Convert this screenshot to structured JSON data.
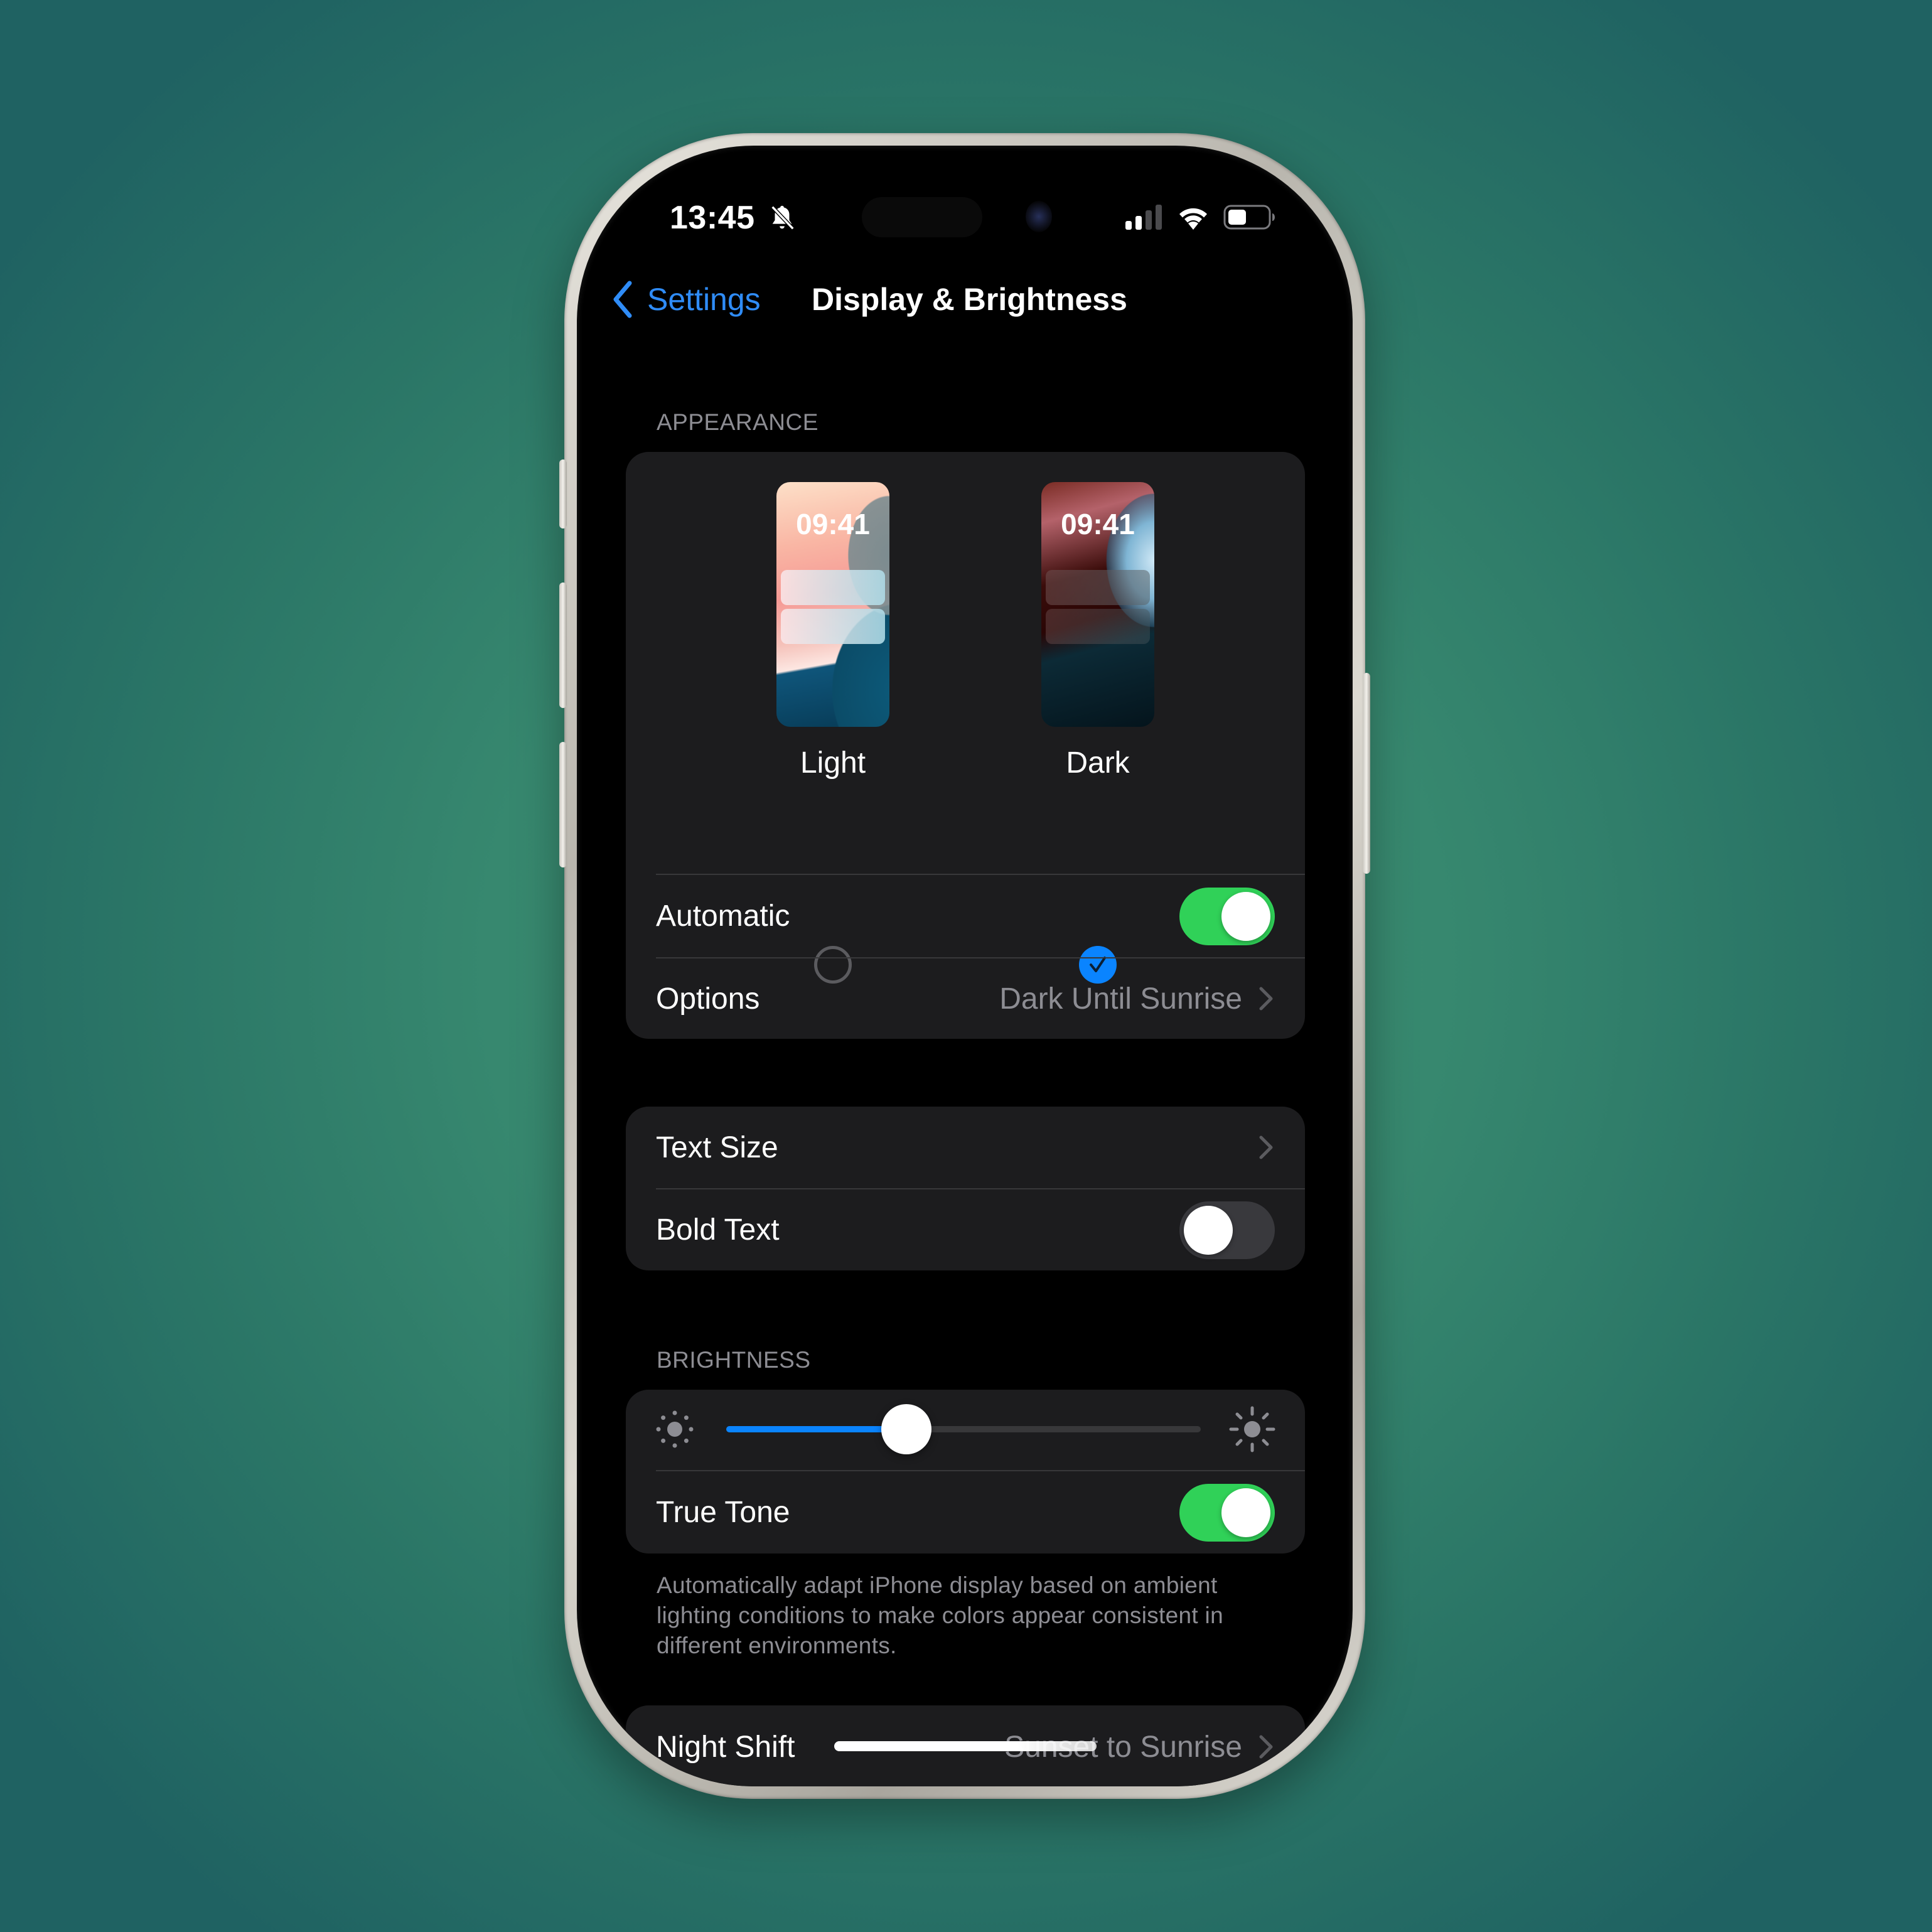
{
  "status_bar": {
    "time": "13:45",
    "silent_mode": true,
    "signal_bars_active": 2,
    "signal_bars_total": 4,
    "battery_level": 0.4
  },
  "nav": {
    "back_label": "Settings",
    "title": "Display & Brightness"
  },
  "appearance": {
    "section_label": "APPEARANCE",
    "modes": [
      {
        "label": "Light",
        "preview_time": "09:41",
        "selected": false
      },
      {
        "label": "Dark",
        "preview_time": "09:41",
        "selected": true
      }
    ],
    "automatic": {
      "label": "Automatic",
      "on": true
    },
    "options": {
      "label": "Options",
      "value": "Dark Until Sunrise"
    }
  },
  "text": {
    "text_size": {
      "label": "Text Size"
    },
    "bold_text": {
      "label": "Bold Text",
      "on": false
    }
  },
  "brightness": {
    "section_label": "BRIGHTNESS",
    "level": 0.38,
    "true_tone": {
      "label": "True Tone",
      "on": true
    },
    "footer": "Automatically adapt iPhone display based on ambient lighting conditions to make colors appear consistent in different environments."
  },
  "night_shift": {
    "label": "Night Shift",
    "value": "Sunset to Sunrise"
  },
  "colors": {
    "accent_blue": "#0a84ff",
    "toggle_green": "#30d158",
    "card_bg": "#1c1c1e",
    "secondary_text": "#8d8d93"
  }
}
